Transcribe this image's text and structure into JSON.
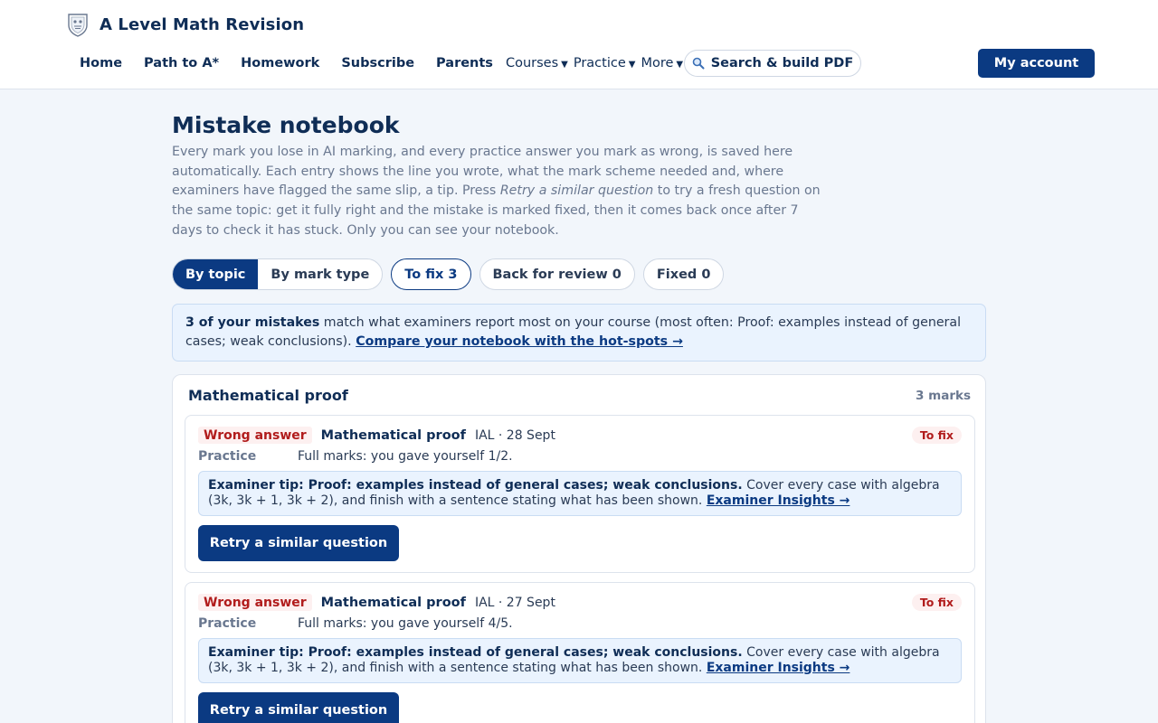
{
  "brand": {
    "name": "A Level Math Revision",
    "logo_icon": "crest-icon"
  },
  "nav": {
    "links": [
      "Home",
      "Path to A*",
      "Homework",
      "Subscribe",
      "Parents"
    ],
    "dropdowns": [
      "Courses",
      "Practice",
      "More"
    ],
    "search_label": "Search & build PDF",
    "account_label": "My account"
  },
  "page": {
    "title": "Mistake notebook",
    "intro_part1": "Every mark you lose in AI marking, and every practice answer you mark as wrong, is saved here automatically. Each entry shows the line you wrote, what the mark scheme needed and, where examiners have flagged the same slip, a tip. Press ",
    "intro_em": "Retry a similar question",
    "intro_part2": " to try a fresh question on the same topic: get it fully right and the mistake is marked fixed, then it comes back once after 7 days to check it has stuck. Only you can see your notebook."
  },
  "filters": {
    "view_options": [
      "By topic",
      "By mark type"
    ],
    "view_selected": "By topic",
    "status_pills": [
      "To fix 3",
      "Back for review 0",
      "Fixed 0"
    ]
  },
  "notice": {
    "strong": "3 of your mistakes",
    "text": " match what examiners report most on your course (most often: Proof: examples instead of general cases; weak conclusions). ",
    "link": "Compare your notebook with the hot-spots →"
  },
  "group": {
    "title": "Mathematical proof",
    "count": "3 marks",
    "cards": [
      {
        "badge": "Wrong answer",
        "topic": "Mathematical proof",
        "meta": "IAL · 28 Sept",
        "status": "To fix",
        "source": "Practice",
        "detail": "Full marks: you gave yourself 1/2.",
        "tip_strong": "Examiner tip: Proof: examples instead of general cases; weak conclusions.",
        "tip_text": " Cover every case with algebra (3k, 3k + 1, 3k + 2), and finish with a sentence stating what has been shown. ",
        "tip_link": "Examiner Insights →",
        "retry_label": "Retry a similar question"
      },
      {
        "badge": "Wrong answer",
        "topic": "Mathematical proof",
        "meta": "IAL · 27 Sept",
        "status": "To fix",
        "source": "Practice",
        "detail": "Full marks: you gave yourself 4/5.",
        "tip_strong": "Examiner tip: Proof: examples instead of general cases; weak conclusions.",
        "tip_text": " Cover every case with algebra (3k, 3k + 1, 3k + 2), and finish with a sentence stating what has been shown. ",
        "tip_link": "Examiner Insights →",
        "retry_label": "Retry a similar question"
      }
    ]
  }
}
